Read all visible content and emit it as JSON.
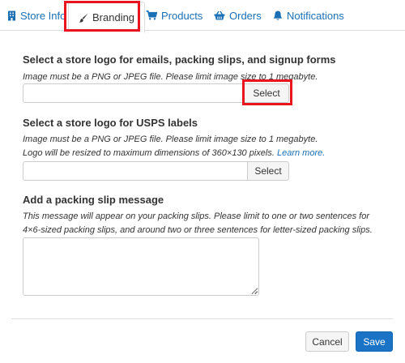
{
  "tabs": [
    {
      "label": "Store Info",
      "icon": "building-icon",
      "active": false
    },
    {
      "label": "Branding",
      "icon": "paintbrush-icon",
      "active": true
    },
    {
      "label": "Products",
      "icon": "cart-icon",
      "active": false
    },
    {
      "label": "Orders",
      "icon": "basket-icon",
      "active": false
    },
    {
      "label": "Notifications",
      "icon": "bell-icon",
      "active": false
    }
  ],
  "logo_section": {
    "heading": "Select a store logo for emails, packing slips, and signup forms",
    "help": "Image must be a PNG or JPEG file. Please limit image size to 1 megabyte.",
    "file_value": "",
    "select_label": "Select"
  },
  "usps_section": {
    "heading": "Select a store logo for USPS labels",
    "help_line1": "Image must be a PNG or JPEG file. Please limit image size to 1 megabyte.",
    "help_line2": "Logo will be resized to maximum dimensions of 360×130 pixels.",
    "learn_more": "Learn more.",
    "file_value": "",
    "select_label": "Select"
  },
  "packing_section": {
    "heading": "Add a packing slip message",
    "help_line1": "This message will appear on your packing slips. Please limit to one or two sentences for",
    "help_line2": "4×6-sized packing slips, and around two or three sentences for letter-sized packing slips.",
    "message_value": ""
  },
  "footer": {
    "cancel_label": "Cancel",
    "save_label": "Save"
  },
  "colors": {
    "link": "#1a6fb5",
    "primary_button": "#1a73c4",
    "highlight": "#e8141f"
  }
}
